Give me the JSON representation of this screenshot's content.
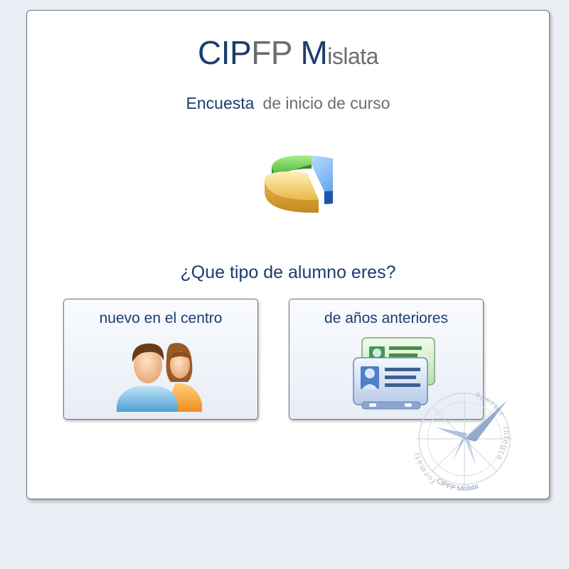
{
  "header": {
    "logo_part1": "CIP",
    "logo_part2": "FP ",
    "logo_part3": "M",
    "logo_part4": "islata",
    "subtitle_strong": "Encuesta",
    "subtitle_light": "de inicio de curso"
  },
  "chart_icon": "pie-chart-icon",
  "question": "¿Que tipo de alumno eres?",
  "options": [
    {
      "label": "nuevo en el centro",
      "icon": "people-icon"
    },
    {
      "label": "de años anteriores",
      "icon": "id-cards-icon"
    }
  ],
  "seal": {
    "arc_left": "formati",
    "arc_right": "eperioris",
    "arc_far_right": "integra",
    "bottom_text": "CIPFP Mislata"
  },
  "colors": {
    "page_background": "#eceef6",
    "brand_dark": "#1b3d6e",
    "brand_grey": "#6a6d72"
  }
}
